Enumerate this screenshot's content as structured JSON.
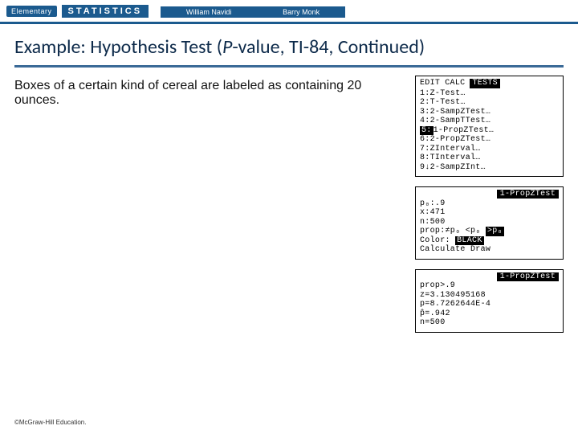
{
  "topbar": {
    "brand_small": "Elementary",
    "brand_big": "STATISTICS",
    "author1": "William Navidi",
    "author2": "Barry Monk"
  },
  "title_pre": "Example: Hypothesis Test (",
  "title_em": "P",
  "title_post": "-value, TI-84, Continued)",
  "prompt": "Boxes of a certain kind of cereal are labeled as containing 20 ounces.",
  "screen1": {
    "h1": "EDIT",
    "h2": "CALC",
    "h3": "TESTS",
    "l1": "1:Z-Test…",
    "l2": "2:T-Test…",
    "l3": "3:2-SampZTest…",
    "l4": "4:2-SampTTest…",
    "l5sel": "5:",
    "l5rest": "1-PropZTest…",
    "l6": "6:2-PropZTest…",
    "l7": "7:ZInterval…",
    "l8": "8:TInterval…",
    "l9": "9↓2-SampZInt…"
  },
  "screen2": {
    "title": "1-PropZTest",
    "l1": "p₀:.9",
    "l2": "x:471",
    "l3": "n:500",
    "l4pre": "prop:≠p₀ <p₀ ",
    "l4sel": ">p₀",
    "l5pre": "Color: ",
    "l5sel": "BLACK",
    "l6": "Calculate Draw"
  },
  "screen3": {
    "title": "1-PropZTest",
    "l1": "prop>.9",
    "l2": "z=3.130495168",
    "l3": "p=8.7262644E-4",
    "l4": "p̂=.942",
    "l5": "n=500"
  },
  "footer": "©McGraw-Hill Education."
}
